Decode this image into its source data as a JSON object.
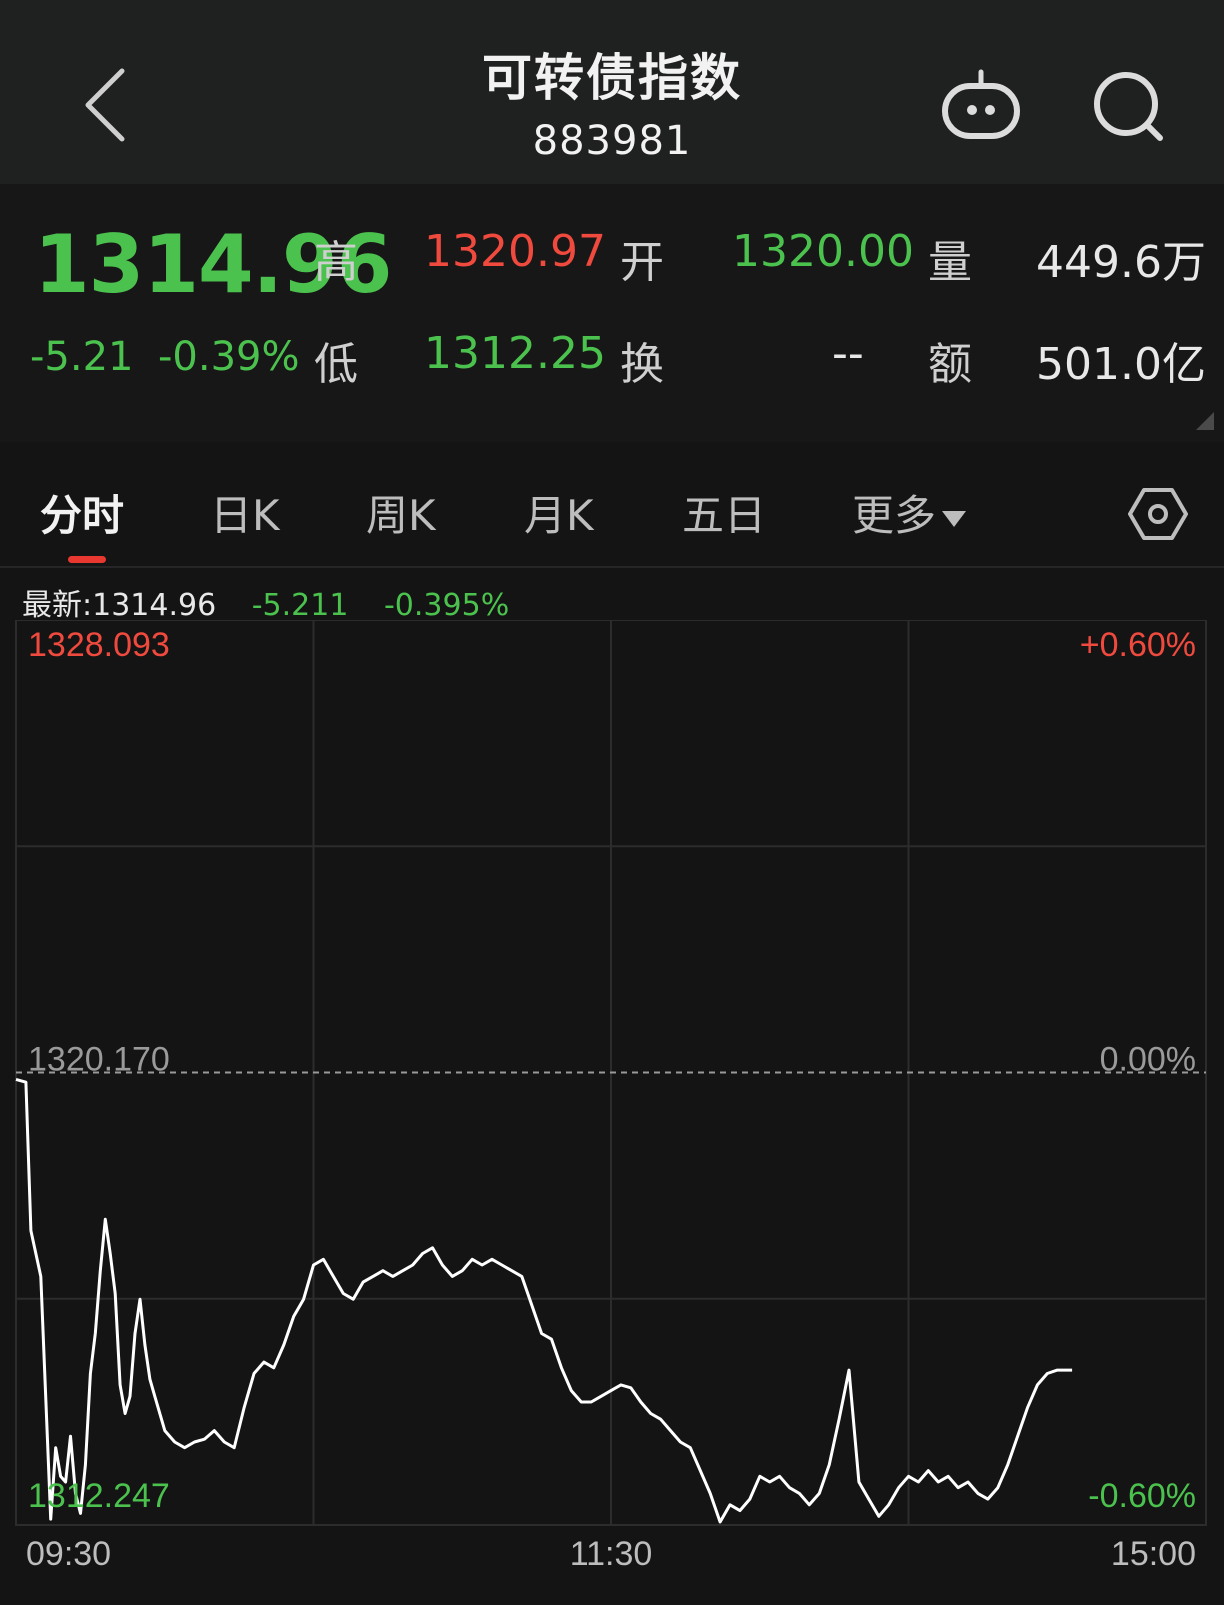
{
  "header": {
    "title": "可转债指数",
    "code": "883981"
  },
  "quote": {
    "price": "1314.96",
    "change": "-5.21",
    "change_pct": "-0.39%",
    "high_label": "高",
    "high": "1320.97",
    "low_label": "低",
    "low": "1312.25",
    "open_label": "开",
    "open": "1320.00",
    "turnover_label": "换",
    "turnover": "--",
    "volume_label": "量",
    "volume": "449.6万",
    "amount_label": "额",
    "amount": "501.0亿"
  },
  "tabs": [
    {
      "label": "分时",
      "active": true
    },
    {
      "label": "日K",
      "active": false
    },
    {
      "label": "周K",
      "active": false
    },
    {
      "label": "月K",
      "active": false
    },
    {
      "label": "五日",
      "active": false
    },
    {
      "label": "更多",
      "active": false
    }
  ],
  "latest": {
    "label": "最新:1314.96",
    "change": "-5.211",
    "change_pct": "-0.395%"
  },
  "colors": {
    "up": "#f04a3e",
    "down": "#4cc24e",
    "line": "#ffffff",
    "grid": "#2c2c2c"
  },
  "chart_data": {
    "type": "line",
    "y_max_label": "1328.093",
    "y_mid_label": "1320.170",
    "y_min_label": "1312.247",
    "pct_max_label": "+0.60%",
    "pct_mid_label": "0.00%",
    "pct_min_label": "-0.60%",
    "x_labels": [
      "09:30",
      "11:30",
      "15:00"
    ],
    "ylim": [
      1312.247,
      1328.093
    ],
    "prev_close": 1320.17,
    "grid": true,
    "x_minutes_total": 240,
    "series": [
      {
        "x": [
          0,
          2,
          3,
          5,
          7,
          8,
          9,
          10,
          11,
          12,
          13,
          14,
          15,
          16,
          17,
          18,
          19,
          20,
          21,
          22,
          23,
          24,
          25,
          26,
          27,
          28,
          30,
          32,
          34,
          36,
          38,
          40,
          42,
          44,
          46,
          48,
          50,
          52,
          54,
          56,
          58,
          60,
          62,
          64,
          66,
          68,
          70,
          72,
          74,
          76,
          78,
          80,
          82,
          84,
          86,
          88,
          90,
          92,
          94,
          96,
          98,
          100,
          102,
          104,
          106,
          108,
          110,
          112,
          114,
          116,
          118,
          120,
          122,
          124,
          126,
          128,
          130,
          132,
          134,
          136,
          138,
          140,
          142,
          144,
          146,
          148,
          150,
          152,
          154,
          156,
          158,
          160,
          162,
          164,
          166,
          168,
          170,
          172,
          174,
          176,
          178,
          180,
          182,
          184,
          186,
          188,
          190,
          192,
          194,
          196,
          198,
          200,
          202,
          204,
          206,
          208,
          210,
          212,
          213
        ],
        "y": [
          1320.05,
          1320.0,
          1317.4,
          1316.6,
          1312.35,
          1313.6,
          1313.1,
          1313.0,
          1313.8,
          1312.8,
          1312.45,
          1313.3,
          1314.9,
          1315.6,
          1316.7,
          1317.6,
          1317.0,
          1316.3,
          1314.7,
          1314.2,
          1314.5,
          1315.6,
          1316.2,
          1315.4,
          1314.8,
          1314.5,
          1313.9,
          1313.7,
          1313.6,
          1313.7,
          1313.75,
          1313.9,
          1313.7,
          1313.6,
          1314.3,
          1314.9,
          1315.1,
          1315.0,
          1315.4,
          1315.9,
          1316.2,
          1316.8,
          1316.9,
          1316.6,
          1316.3,
          1316.2,
          1316.5,
          1316.6,
          1316.7,
          1316.6,
          1316.7,
          1316.8,
          1317.0,
          1317.1,
          1316.8,
          1316.6,
          1316.7,
          1316.9,
          1316.8,
          1316.9,
          1316.8,
          1316.7,
          1316.6,
          1316.1,
          1315.6,
          1315.5,
          1315.0,
          1314.6,
          1314.4,
          1314.4,
          1314.5,
          1314.6,
          1314.7,
          1314.65,
          1314.4,
          1314.2,
          1314.1,
          1313.9,
          1313.7,
          1313.6,
          1313.2,
          1312.8,
          1312.3,
          1312.6,
          1312.5,
          1312.7,
          1313.1,
          1313.0,
          1313.1,
          1312.9,
          1312.8,
          1312.6,
          1312.8,
          1313.3,
          1314.1,
          1314.96,
          1313.0,
          1312.7,
          1312.4,
          1312.6,
          1312.9,
          1313.1,
          1313.0,
          1313.2,
          1313.0,
          1313.1,
          1312.9,
          1313.0,
          1312.8,
          1312.7,
          1312.9,
          1313.3,
          1313.8,
          1314.3,
          1314.7,
          1314.9,
          1314.96,
          1314.96,
          1314.96
        ]
      }
    ]
  }
}
